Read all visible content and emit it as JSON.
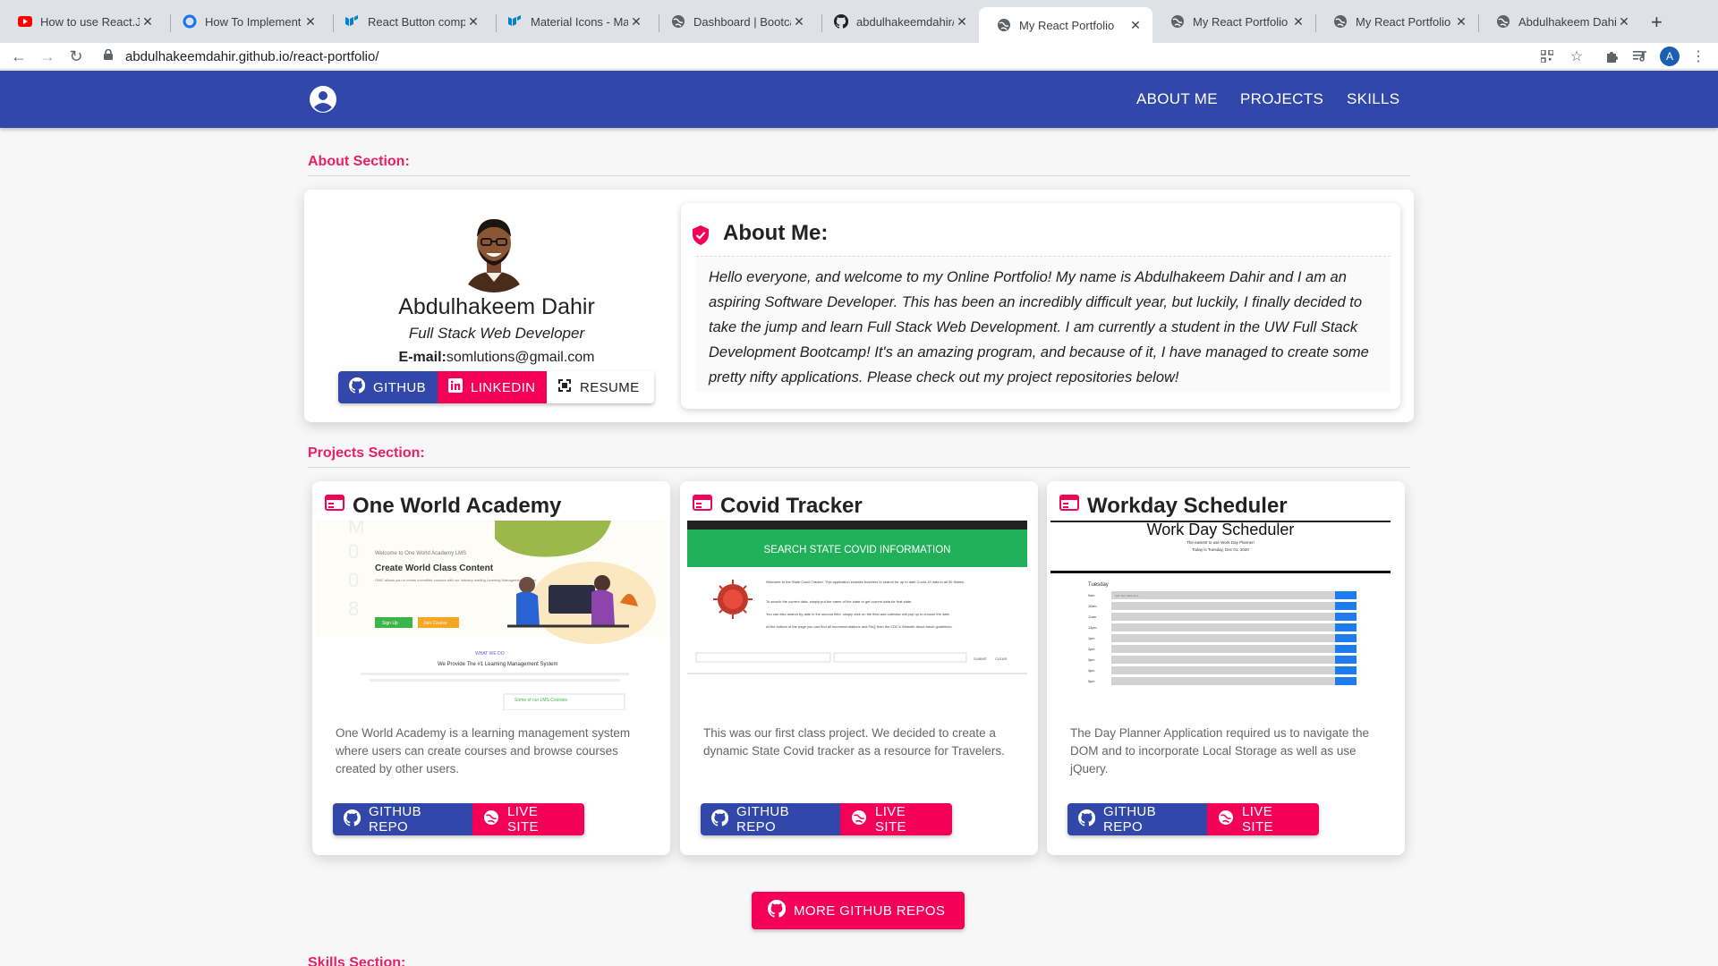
{
  "browser": {
    "tabs": [
      {
        "title": "How to use React.JS",
        "icon": "youtube-icon"
      },
      {
        "title": "How To Implement S",
        "icon": "site-icon"
      },
      {
        "title": "React Button compo",
        "icon": "material-ui-icon"
      },
      {
        "title": "Material Icons - Mate",
        "icon": "material-ui-icon"
      },
      {
        "title": "Dashboard | Bootcam",
        "icon": "globe-icon"
      },
      {
        "title": "abdulhakeemdahir/re",
        "icon": "github-icon"
      },
      {
        "title": "My React Portfolio",
        "icon": "globe-icon",
        "active": true
      },
      {
        "title": "My React Portfolio",
        "icon": "globe-icon"
      },
      {
        "title": "My React Portfolio",
        "icon": "globe-icon"
      },
      {
        "title": "Abdulhakeem Dahir |",
        "icon": "globe-icon"
      }
    ],
    "url": "abdulhakeemdahir.github.io/react-portfolio/",
    "profile_initial": "A"
  },
  "nav": {
    "links": [
      "ABOUT ME",
      "PROJECTS",
      "SKILLS"
    ]
  },
  "colors": {
    "primary": "#3247aa",
    "secondary": "#f50057",
    "section_label": "#e91e63"
  },
  "about": {
    "section_label": "About Section:",
    "name": "Abdulhakeem Dahir",
    "role": "Full Stack Web Developer",
    "email_label": "E-mail:",
    "email": "somlutions@gmail.com",
    "buttons": {
      "github": "GITHUB",
      "linkedin": "LINKEDIN",
      "resume": "RESUME"
    },
    "title": "About Me:",
    "text": "Hello everyone, and welcome to my Online Portfolio! My name is Abdulhakeem Dahir and I am an aspiring Software Developer. This has been an incredibly difficult year, but luckily, I finally decided to take the jump and learn Full Stack Web Development. I am currently a student in the UW Full Stack Development Bootcamp! It's an amazing program, and because of it, I have managed to create some pretty nifty applications. Please check out my project repositories below!"
  },
  "projects": {
    "section_label": "Projects Section:",
    "repo_label": "GITHUB REPO",
    "live_label": "LIVE SITE",
    "items": [
      {
        "title": "One World Academy",
        "description": "One World Academy is a learning management system where users can create courses and browse courses created by other users.",
        "screenshot": {
          "welcome": "Welcome to One World Academy LMS",
          "heading": "Create World Class Content",
          "blurb": "OWC allows you to create incredible courses with our industry leading Learning Management System!",
          "btn1": "Sign Up",
          "btn2": "Join Course",
          "what": "WHAT WE DO",
          "provide": "We Provide The #1 Learning Management System",
          "some": "Some of our LMS Courses"
        }
      },
      {
        "title": "Covid Tracker",
        "description": "This was our first class project. We decided to create a dynamic State Covid tracker as a resource for Travelers.",
        "screenshot": {
          "banner": "SEARCH STATE COVID INFORMATION",
          "line1": "Welcome to the State Covid Tracker. This application enables travelers to search for up to date Covid-19 data in all 50 States.",
          "line2": "To search the current data, simply put the name of the state to get current data for that state.",
          "line3": "You can also search by date in the second field, simply click on the field and calendar will pop up to choose the date.",
          "line4": "At the bottom of the page you can find all recommendations and FAQ from the CDC's Website about travel guidelines.",
          "submit": "SUBMIT",
          "clear": "CLEAR"
        }
      },
      {
        "title": "Workday Scheduler",
        "description": "The Day Planner Application required us to navigate the DOM and to incorporate Local Storage as well as use jQuery.",
        "screenshot": {
          "heading": "Work Day Scheduler",
          "sub1": "The easiest to use Work Day Planner!",
          "sub2": "Today is Tuesday, Dec 01, 2020",
          "day": "Tuesday",
          "hours": [
            "9am",
            "10am",
            "11am",
            "12pm",
            "1pm",
            "2pm",
            "3pm",
            "4pm",
            "5pm"
          ],
          "placeholder": "Add Your Task Here"
        }
      }
    ],
    "more_label": "MORE GITHUB REPOS"
  },
  "skills": {
    "section_label": "Skills Section:"
  }
}
